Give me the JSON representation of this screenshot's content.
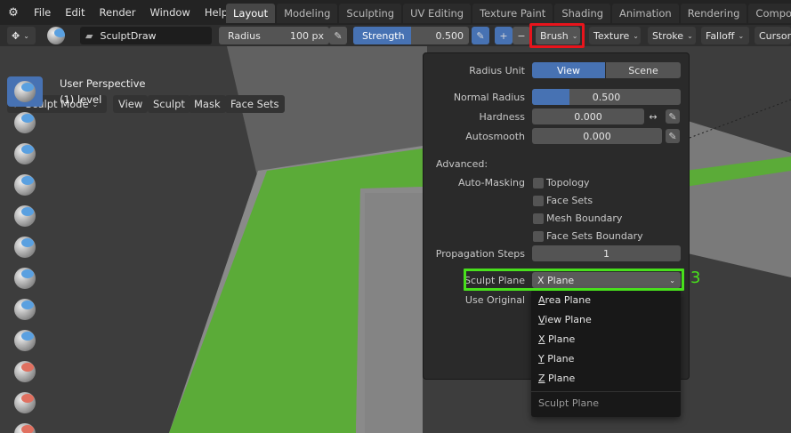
{
  "menubar": {
    "items": [
      "File",
      "Edit",
      "Render",
      "Window",
      "Help"
    ],
    "workspace_tabs": [
      {
        "label": "Layout",
        "active": true
      },
      {
        "label": "Modeling",
        "active": false
      },
      {
        "label": "Sculpting",
        "active": false
      },
      {
        "label": "UV Editing",
        "active": false
      },
      {
        "label": "Texture Paint",
        "active": false
      },
      {
        "label": "Shading",
        "active": false
      },
      {
        "label": "Animation",
        "active": false
      },
      {
        "label": "Rendering",
        "active": false
      },
      {
        "label": "Compositing",
        "active": false
      }
    ]
  },
  "toolsettings": {
    "brush_name": "SculptDraw",
    "radius_label": "Radius",
    "radius_value": "100 px",
    "strength_label": "Strength",
    "strength_value": "0.500",
    "plus": "+",
    "minus": "−",
    "brush_menu": "Brush",
    "texture_menu": "Texture",
    "stroke_menu": "Stroke",
    "falloff_menu": "Falloff",
    "cursor_menu": "Cursor"
  },
  "header2": {
    "mode": "Sculpt Mode",
    "view": "View",
    "sculpt": "Sculpt",
    "mask": "Mask",
    "face_sets": "Face Sets"
  },
  "viewport": {
    "perspective": "User Perspective",
    "object": "(1) level"
  },
  "brush_panel": {
    "radius_unit_label": "Radius Unit",
    "radius_unit_view": "View",
    "radius_unit_scene": "Scene",
    "normal_radius_label": "Normal Radius",
    "normal_radius_value": "0.500",
    "normal_radius_fraction": 0.25,
    "hardness_label": "Hardness",
    "hardness_value": "0.000",
    "autosmooth_label": "Autosmooth",
    "autosmooth_value": "0.000",
    "advanced_label": "Advanced:",
    "automasking_label": "Auto-Masking",
    "checkboxes": [
      "Topology",
      "Face Sets",
      "Mesh Boundary",
      "Face Sets Boundary"
    ],
    "propagation_label": "Propagation Steps",
    "propagation_value": "1",
    "sculpt_plane_label": "Sculpt Plane",
    "sculpt_plane_value": "X Plane",
    "use_original_label": "Use Original"
  },
  "plane_menu": {
    "items": [
      {
        "first": "A",
        "rest": "rea Plane"
      },
      {
        "first": "V",
        "rest": "iew Plane"
      },
      {
        "first": "X",
        "rest": " Plane"
      },
      {
        "first": "Y",
        "rest": " Plane"
      },
      {
        "first": "Z",
        "rest": " Plane"
      }
    ],
    "footer": "Sculpt Plane"
  },
  "annotation": {
    "step_number": "3",
    "red_color": "#e8141c",
    "green_color": "#48e01c"
  }
}
